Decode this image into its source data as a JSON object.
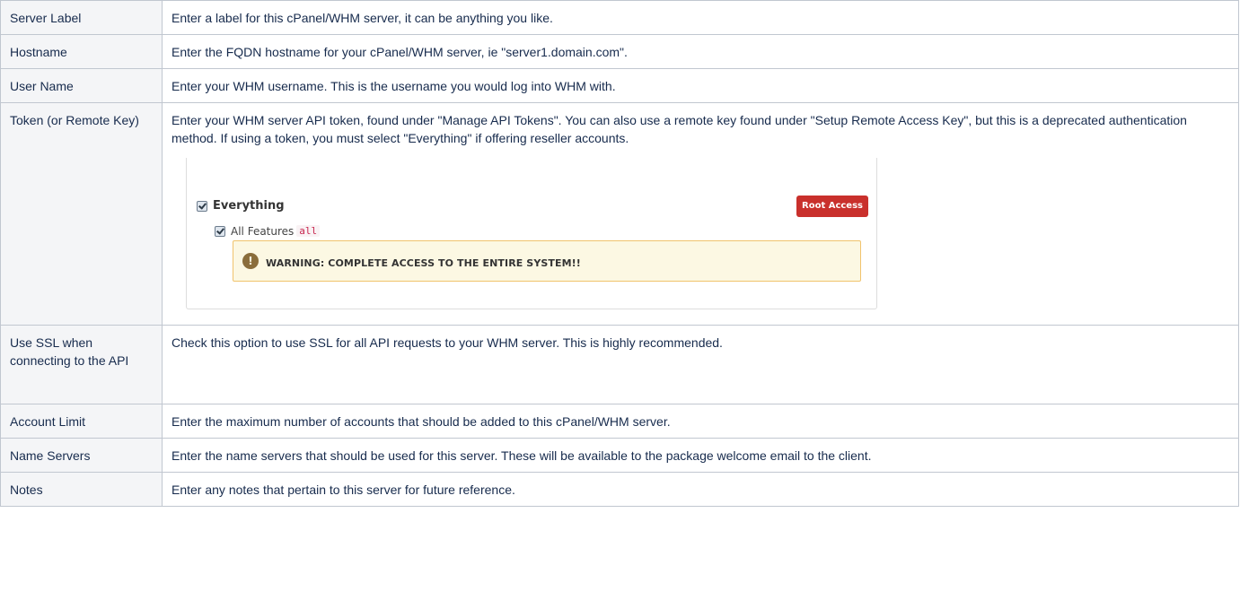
{
  "rows": [
    {
      "label": "Server Label",
      "desc": "Enter a label for this cPanel/WHM server, it can be anything you like."
    },
    {
      "label": "Hostname",
      "desc": "Enter the FQDN hostname for your cPanel/WHM server, ie \"server1.domain.com\"."
    },
    {
      "label": "User Name",
      "desc": "Enter your WHM username. This is the username you would log into WHM with."
    },
    {
      "label": "Token (or Remote Key)",
      "desc": "Enter your WHM server API token, found under \"Manage API Tokens\". You can also use a remote key found under \"Setup Remote Access Key\", but this is a deprecated authentication method. If using a token, you must select \"Everything\" if offering reseller accounts."
    },
    {
      "label": "Use SSL when connecting to the API",
      "desc": "Check this option to use SSL for all API requests to your WHM server. This is highly recommended."
    },
    {
      "label": "Account Limit",
      "desc": "Enter the maximum number of accounts that should be added to this cPanel/WHM server."
    },
    {
      "label": "Name Servers",
      "desc": "Enter the name servers that should be used for this server. These will be available to the package welcome email to the client."
    },
    {
      "label": "Notes",
      "desc": "Enter any notes that pertain to this server for future reference."
    }
  ],
  "screenshot": {
    "everything_label": "Everything",
    "badge": "Root Access",
    "all_features_label": "All Features",
    "all_features_code": "all",
    "warning_icon": "!",
    "warning_text": "WARNING: COMPLETE ACCESS TO THE ENTIRE SYSTEM!!",
    "colors": {
      "badge": "#c9302c",
      "warning_bg": "#fcf8e3",
      "warning_border": "#f0c36d"
    }
  }
}
